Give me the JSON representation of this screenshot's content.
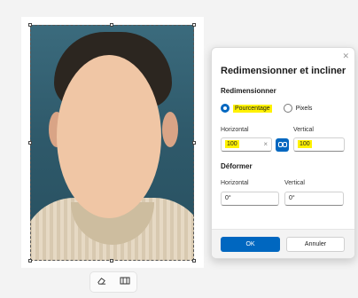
{
  "dialog": {
    "title": "Redimensionner et incliner",
    "close_icon": "close-icon",
    "resize_section": "Redimensionner",
    "options": [
      {
        "label": "Pourcentage",
        "selected": true
      },
      {
        "label": "Pixels",
        "selected": false
      }
    ],
    "horizontal_label": "Horizontal",
    "vertical_label": "Vertical",
    "horizontal_value": "100",
    "vertical_value": "100",
    "clear_glyph": "×",
    "lock_icon": "link-icon",
    "skew_section": "Déformer",
    "skew_horizontal_label": "Horizontal",
    "skew_vertical_label": "Vertical",
    "skew_horizontal_value": "0°",
    "skew_vertical_value": "0°",
    "ok_label": "OK",
    "cancel_label": "Annuler"
  },
  "mini_toolbar": {
    "icons": [
      "eraser-icon",
      "image-icon"
    ]
  },
  "colors": {
    "accent": "#0067c0",
    "highlight": "#fff200"
  }
}
